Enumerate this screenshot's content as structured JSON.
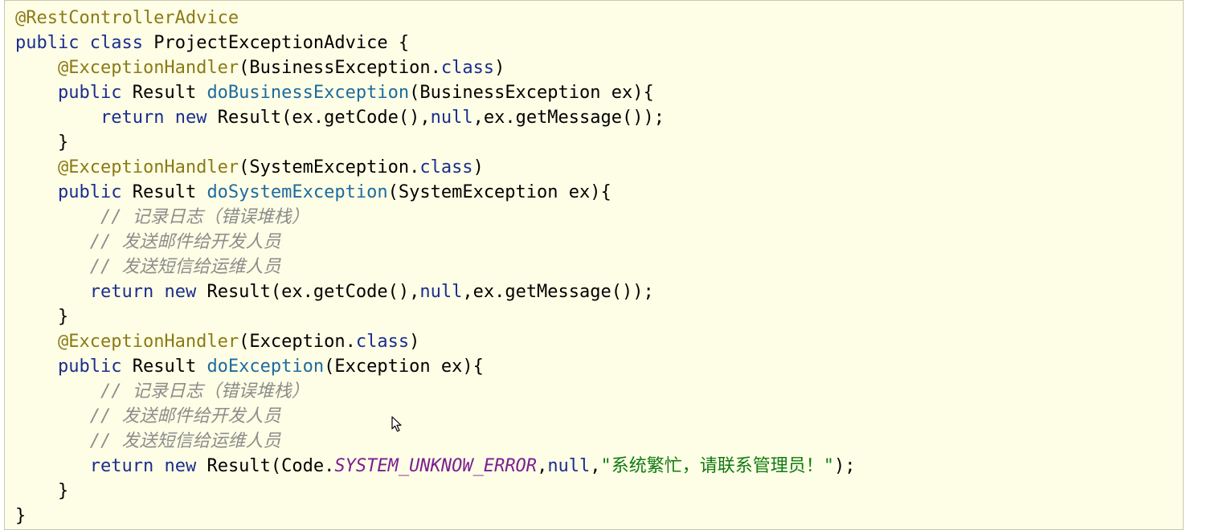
{
  "code": {
    "lines": [
      [
        {
          "t": "@RestControllerAdvice",
          "c": "ann"
        }
      ],
      [
        {
          "t": "public",
          "c": "kw"
        },
        {
          "t": " "
        },
        {
          "t": "class",
          "c": "kw"
        },
        {
          "t": " ProjectExceptionAdvice {"
        }
      ],
      [
        {
          "t": "    "
        },
        {
          "t": "@ExceptionHandler",
          "c": "ann"
        },
        {
          "t": "(BusinessException."
        },
        {
          "t": "class",
          "c": "kw"
        },
        {
          "t": ")"
        }
      ],
      [
        {
          "t": "    "
        },
        {
          "t": "public",
          "c": "kw"
        },
        {
          "t": " Result "
        },
        {
          "t": "doBusinessException",
          "c": "method"
        },
        {
          "t": "(BusinessException ex){"
        }
      ],
      [
        {
          "t": "        "
        },
        {
          "t": "return",
          "c": "kw"
        },
        {
          "t": " "
        },
        {
          "t": "new",
          "c": "kw"
        },
        {
          "t": " Result(ex.getCode(),"
        },
        {
          "t": "null",
          "c": "kw"
        },
        {
          "t": ",ex.getMessage());"
        }
      ],
      [
        {
          "t": "    }"
        }
      ],
      [
        {
          "t": "    "
        },
        {
          "t": "@ExceptionHandler",
          "c": "ann"
        },
        {
          "t": "(SystemException."
        },
        {
          "t": "class",
          "c": "kw"
        },
        {
          "t": ")"
        }
      ],
      [
        {
          "t": "    "
        },
        {
          "t": "public",
          "c": "kw"
        },
        {
          "t": " Result "
        },
        {
          "t": "doSystemException",
          "c": "method"
        },
        {
          "t": "(SystemException ex){"
        }
      ],
      [
        {
          "t": "        "
        },
        {
          "t": "// 记录日志（错误堆栈）",
          "c": "cmt"
        }
      ],
      [
        {
          "t": "       "
        },
        {
          "t": "// 发送邮件给开发人员",
          "c": "cmt"
        }
      ],
      [
        {
          "t": "       "
        },
        {
          "t": "// 发送短信给运维人员",
          "c": "cmt"
        }
      ],
      [
        {
          "t": "       "
        },
        {
          "t": "return",
          "c": "kw"
        },
        {
          "t": " "
        },
        {
          "t": "new",
          "c": "kw"
        },
        {
          "t": " Result(ex.getCode(),"
        },
        {
          "t": "null",
          "c": "kw"
        },
        {
          "t": ",ex.getMessage());"
        }
      ],
      [
        {
          "t": "    }"
        }
      ],
      [
        {
          "t": "    "
        },
        {
          "t": "@ExceptionHandler",
          "c": "ann"
        },
        {
          "t": "(Exception."
        },
        {
          "t": "class",
          "c": "kw"
        },
        {
          "t": ")"
        }
      ],
      [
        {
          "t": "    "
        },
        {
          "t": "public",
          "c": "kw"
        },
        {
          "t": " Result "
        },
        {
          "t": "doException",
          "c": "method"
        },
        {
          "t": "(Exception ex){"
        }
      ],
      [
        {
          "t": "        "
        },
        {
          "t": "// 记录日志（错误堆栈）",
          "c": "cmt"
        }
      ],
      [
        {
          "t": "       "
        },
        {
          "t": "// 发送邮件给开发人员",
          "c": "cmt"
        }
      ],
      [
        {
          "t": "       "
        },
        {
          "t": "// 发送短信给运维人员",
          "c": "cmt"
        }
      ],
      [
        {
          "t": "       "
        },
        {
          "t": "return",
          "c": "kw"
        },
        {
          "t": " "
        },
        {
          "t": "new",
          "c": "kw"
        },
        {
          "t": " Result(Code."
        },
        {
          "t": "SYSTEM_UNKNOW_ERROR",
          "c": "const"
        },
        {
          "t": ","
        },
        {
          "t": "null",
          "c": "kw"
        },
        {
          "t": ","
        },
        {
          "t": "\"系统繁忙，请联系管理员！\"",
          "c": "str"
        },
        {
          "t": ");"
        }
      ],
      [
        {
          "t": "    }"
        }
      ],
      [
        {
          "t": "}"
        }
      ]
    ]
  },
  "icons": {
    "cursor": "mouse-pointer-icon"
  }
}
